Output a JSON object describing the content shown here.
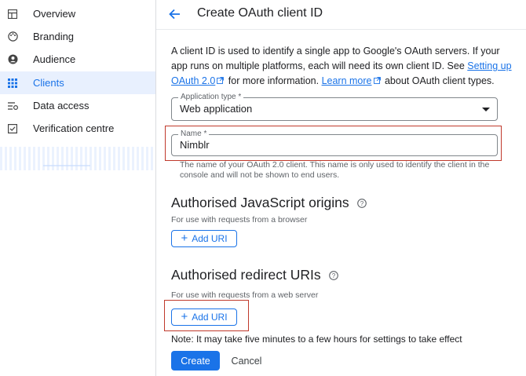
{
  "sidebar": {
    "items": [
      {
        "label": "Overview",
        "icon": "dashboard-icon"
      },
      {
        "label": "Branding",
        "icon": "palette-icon"
      },
      {
        "label": "Audience",
        "icon": "account-circle-icon"
      },
      {
        "label": "Clients",
        "icon": "grid-icon",
        "active": true
      },
      {
        "label": "Data access",
        "icon": "tune-icon"
      },
      {
        "label": "Verification centre",
        "icon": "checkbox-icon"
      }
    ]
  },
  "header": {
    "title": "Create OAuth client ID"
  },
  "intro": {
    "text1": "A client ID is used to identify a single app to Google's OAuth servers. If your app runs on multiple platforms, each will need its own client ID. See ",
    "link1": "Setting up OAuth 2.0",
    "text2": " for more information. ",
    "link2": "Learn more",
    "text3": " about OAuth client types."
  },
  "app_type": {
    "label": "Application type *",
    "value": "Web application"
  },
  "name": {
    "label": "Name *",
    "value": "Nimblr",
    "helper": "The name of your OAuth 2.0 client. This name is only used to identify the client in the console and will not be shown to end users."
  },
  "js_origins": {
    "title": "Authorised JavaScript origins",
    "subtitle": "For use with requests from a browser",
    "button": "Add URI"
  },
  "redirect_uris": {
    "title": "Authorised redirect URIs",
    "subtitle": "For use with requests from a web server",
    "button": "Add URI"
  },
  "note": "Note: It may take five minutes to a few hours for settings to take effect",
  "actions": {
    "create": "Create",
    "cancel": "Cancel"
  },
  "colors": {
    "accent": "#1a73e8",
    "highlight": "#c0392b",
    "active_bg": "#e8f0fe"
  }
}
